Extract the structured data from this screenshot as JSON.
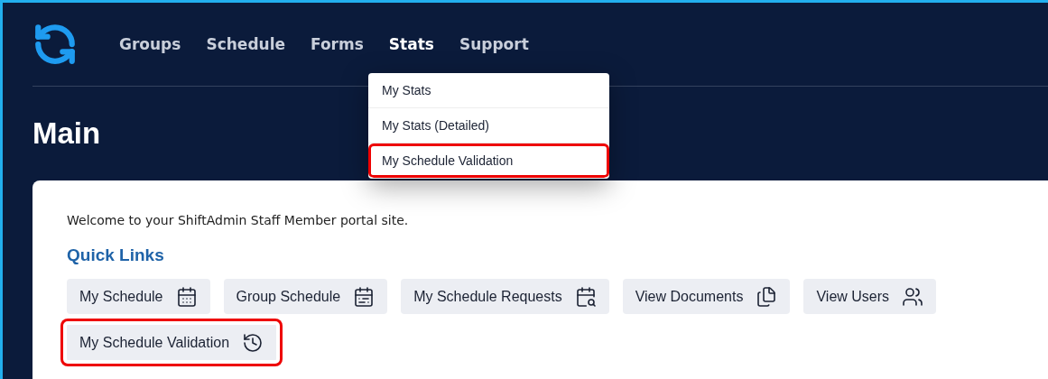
{
  "nav": [
    {
      "label": "Groups",
      "selected": false
    },
    {
      "label": "Schedule",
      "selected": false
    },
    {
      "label": "Forms",
      "selected": false
    },
    {
      "label": "Stats",
      "selected": true
    },
    {
      "label": "Support",
      "selected": false
    }
  ],
  "dropdown": [
    {
      "label": "My Stats",
      "highlighted": false
    },
    {
      "label": "My Stats (Detailed)",
      "highlighted": false
    },
    {
      "label": "My Schedule Validation",
      "highlighted": true
    }
  ],
  "page_title": "Main",
  "welcome": "Welcome to your ShiftAdmin Staff Member portal site.",
  "quick_links_title": "Quick Links",
  "quick_links": [
    {
      "label": "My Schedule",
      "highlighted": false
    },
    {
      "label": "Group Schedule",
      "highlighted": false
    },
    {
      "label": "My Schedule Requests",
      "highlighted": false
    },
    {
      "label": "View Documents",
      "highlighted": false
    },
    {
      "label": "View Users",
      "highlighted": false
    },
    {
      "label": "My Schedule Validation",
      "highlighted": true
    }
  ]
}
